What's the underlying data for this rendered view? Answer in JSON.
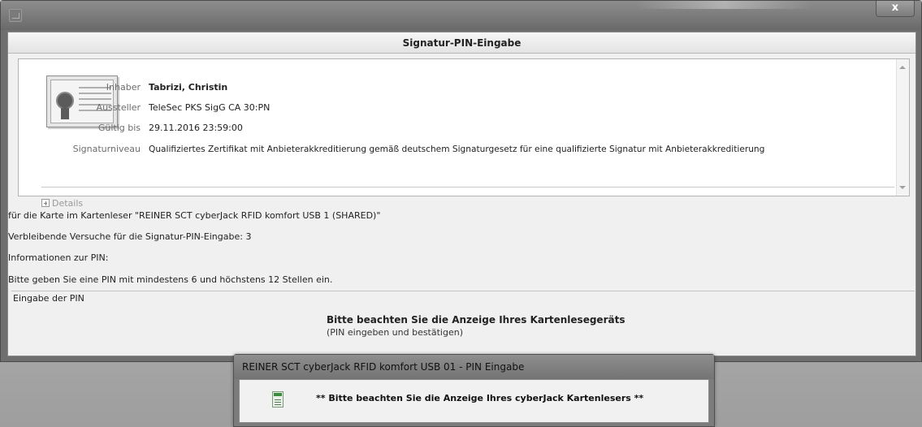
{
  "main_window": {
    "close_label": "x",
    "header_title": "Signatur-PIN-Eingabe"
  },
  "certificate": {
    "fields": [
      {
        "key": "Inhaber",
        "value": "Tabrizi, Christin"
      },
      {
        "key": "Aussteller",
        "value": "TeleSec PKS SigG CA 30:PN"
      },
      {
        "key": "Gültig bis",
        "value": "29.11.2016 23:59:00"
      },
      {
        "key": "Signaturniveau",
        "value": "Qualifiziertes Zertifikat mit Anbieterakkreditierung gemäß deutschem Signaturgesetz für eine qualifizierte Signatur mit Anbieterakkreditierung"
      }
    ],
    "details_label": "Details"
  },
  "info": {
    "card_reader_line": "für die Karte im Kartenleser \"REINER SCT cyberJack RFID komfort USB 1 (SHARED)\"",
    "attempts_line": "Verbleibende Versuche für die Signatur-PIN-Eingabe: 3",
    "pin_info_heading": "Informationen zur PIN:",
    "pin_rule_line": "Bitte geben Sie eine PIN mit mindestens 6 und höchstens 12 Stellen ein."
  },
  "pin_entry": {
    "group_label": "Eingabe der PIN",
    "hint_title": "Bitte beachten Sie die Anzeige Ihres Kartenlesegeräts",
    "hint_sub": "(PIN eingeben und bestätigen)"
  },
  "reader_dialog": {
    "title": "REINER SCT cyberJack RFID komfort USB 01 - PIN Eingabe",
    "message": "** Bitte beachten Sie die Anzeige Ihres cyberJack Kartenlesers **"
  }
}
